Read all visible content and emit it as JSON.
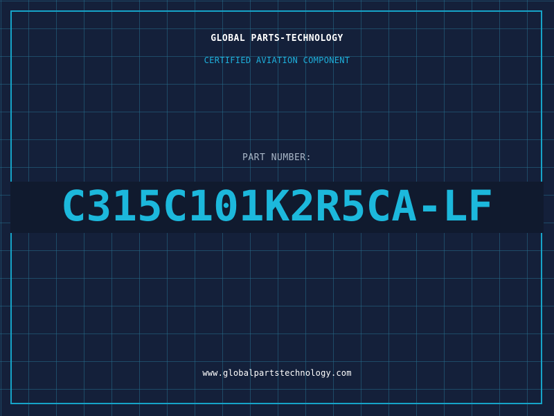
{
  "header": {
    "company_name": "GLOBAL PARTS-TECHNOLOGY",
    "tagline": "CERTIFIED AVIATION COMPONENT"
  },
  "part": {
    "label": "PART NUMBER:",
    "number": "C315C101K2R5CA-LF"
  },
  "footer": {
    "website": "www.globalpartstechnology.com"
  },
  "colors": {
    "background": "#14203a",
    "grid": "#266e8c",
    "accent": "#1cb8dc",
    "text": "#ffffff"
  }
}
